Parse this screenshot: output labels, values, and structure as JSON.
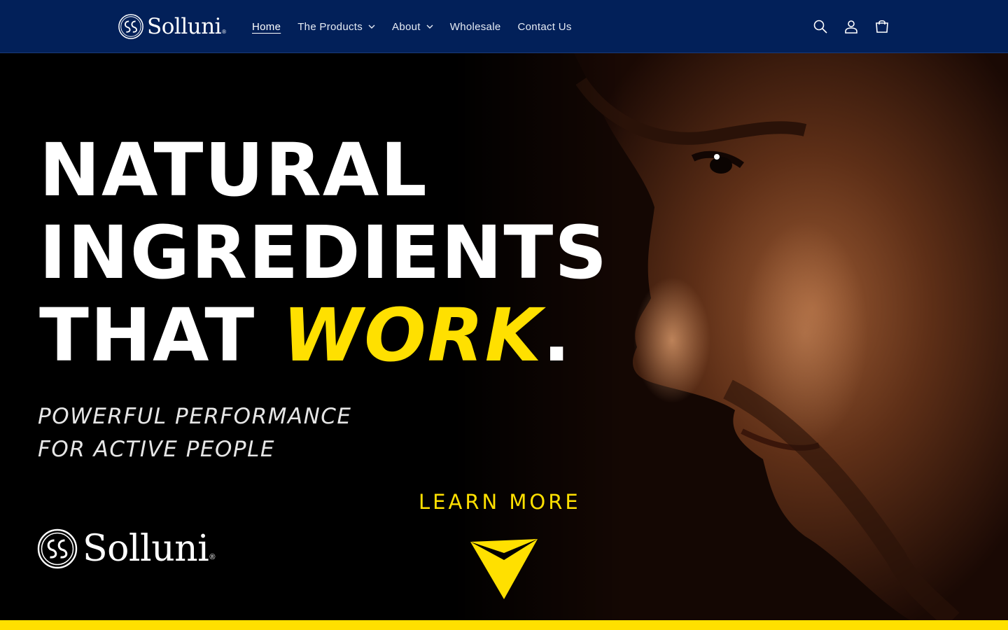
{
  "brand": {
    "name": "Solluni",
    "reg": "®"
  },
  "nav": {
    "home": "Home",
    "products": "The Products",
    "about": "About",
    "wholesale": "Wholesale",
    "contact": "Contact Us"
  },
  "header_icons": [
    "search-icon",
    "account-icon",
    "cart-icon"
  ],
  "hero": {
    "line1": "NATURAL",
    "line2": "INGREDIENTS",
    "line3_a": "THAT ",
    "line3_b": "WORK",
    "line3_c": ".",
    "sub1": "POWERFUL PERFORMANCE",
    "sub2": "FOR ACTIVE PEOPLE",
    "cta": "LEARN MORE"
  },
  "colors": {
    "header": "#022059",
    "accent": "#ffe000",
    "text": "#ffffff"
  }
}
